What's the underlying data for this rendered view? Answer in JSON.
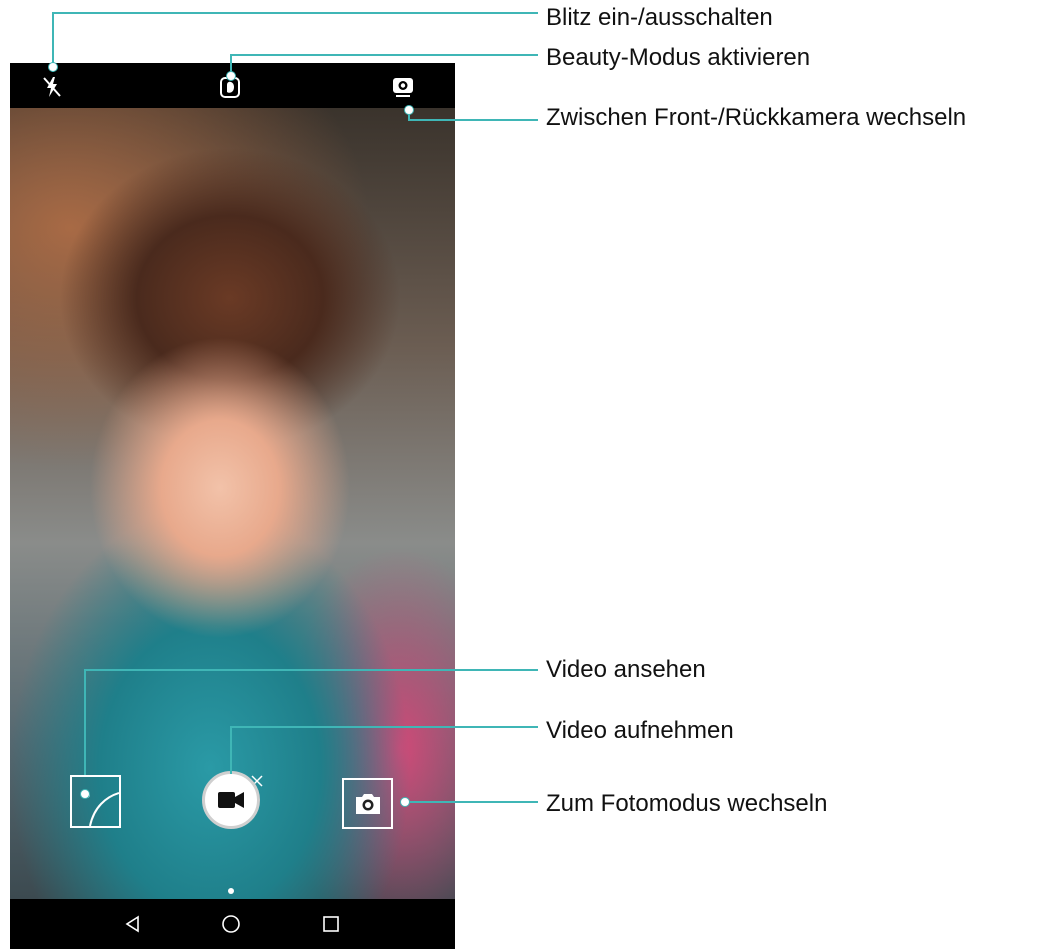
{
  "annotations": {
    "flash": "Blitz ein-/ausschalten",
    "beauty": "Beauty-Modus aktivieren",
    "switch_camera": "Zwischen Front-/Rückkamera wechseln",
    "view_video": "Video ansehen",
    "record_video": "Video aufnehmen",
    "photo_mode": "Zum Fotomodus wechseln"
  },
  "icons": {
    "flash": "flash-off-icon",
    "beauty": "beauty-icon",
    "switch_camera": "switch-camera-icon",
    "thumbnail": "gallery-thumbnail-icon",
    "record": "video-camera-icon",
    "photo_mode": "camera-icon",
    "close": "close-icon",
    "nav_back": "back-triangle-icon",
    "nav_home": "home-circle-icon",
    "nav_recents": "recents-square-icon"
  },
  "colors": {
    "annotation_line": "#3fb6b6",
    "bars": "#000000"
  }
}
